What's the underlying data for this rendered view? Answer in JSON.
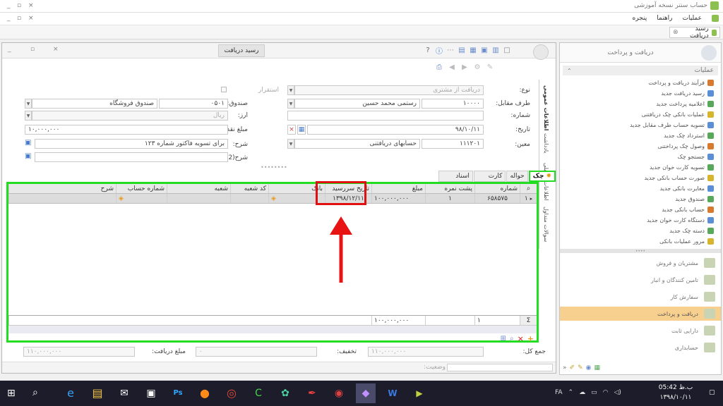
{
  "app": {
    "title": "حساب سنتر نسخه آموزشی"
  },
  "menu": {
    "items": [
      "عملیات",
      "راهنما",
      "پنجره"
    ]
  },
  "doc_tab": {
    "label": "رسید دریافت"
  },
  "window": {
    "title": "رسید دریافت"
  },
  "side_tabs": [
    "اطلاعات عمومی",
    "یادداشت",
    "اطلاعات تکمیلی",
    "سوالات متداول"
  ],
  "form": {
    "type_label": "نوع:",
    "type_value": "دریافت از مشتری",
    "counterparty_label": "طرف مقابل:",
    "counterparty_code": "۱۰۰۰۰",
    "counterparty_name": "رستمی محمد حسین",
    "number_label": "شماره:",
    "date_label": "تاریخ:",
    "date_value": "۹۸/۱۰/۱۱",
    "entity_label": "معین:",
    "entity_code": "۱۱۱۲۰۱",
    "entity_name": "حسابهای دریافتنی",
    "fund_label": "صندوق:",
    "fund_code": "۰۵۰۱",
    "fund_name": "صندوق فروشگاه",
    "currency_label": "ارز:",
    "currency_value": "ریال",
    "cash_label": "مبلغ نقد:",
    "cash_value": "۱۰,۰۰۰,۰۰۰",
    "desc_label": "شرح:",
    "desc_value": "برای تسویه فاکتور شماره ۱۲۳",
    "desc2_label": "شرح(2):",
    "fixed_label": "استقرار"
  },
  "detail_tabs": [
    "چک",
    "حواله",
    "کارت خوان",
    "اسناد مرتبط"
  ],
  "grid": {
    "columns": [
      "شماره",
      "پشت نمره",
      "مبلغ",
      "تاریخ سررسید",
      "بانک",
      "کد شعبه",
      "شعبه",
      "شماره حساب",
      "شرح"
    ],
    "rows": [
      [
        "۶۵۸۵۷۵",
        "۱",
        "۱۰۰,۰۰۰,۰۰۰",
        "۱۳۹۸/۱۲/۱۱",
        "",
        "",
        "",
        "",
        ""
      ]
    ],
    "row_num": "۱",
    "footer_count": "۱",
    "footer_sum": "۱۰۰,۰۰۰,۰۰۰"
  },
  "totals": {
    "total_label": "جمع کل:",
    "total_value": "۱۱۰,۰۰۰,۰۰۰",
    "discount_label": "تخفیف:",
    "discount_value": "۰",
    "received_label": "مبلغ دریافت:",
    "received_value": "۱۱۰,۰۰۰,۰۰۰",
    "status_label": "وضعیت:"
  },
  "panel": {
    "header": "دریافت و پرداخت",
    "ops_title": "عملیات",
    "ops": [
      "فرآیند دریافت و پرداخت",
      "رسید دریافت جدید",
      "اعلامیه پرداخت جدید",
      "عملیات بانکی چک دریافتنی",
      "تسویه حساب طرف مقابل جدید",
      "استرداد چک جدید",
      "وصول چک پرداختنی",
      "جستجو چک",
      "تسویه کارت خوان جدید",
      "صورت حساب بانکی جدید",
      "مغایرت بانکی جدید",
      "صندوق جدید",
      "حساب بانکی جدید",
      "دستگاه کارت خوان جدید",
      "دسته چک جدید",
      "مرور عملیات بانکی"
    ],
    "ops_colors": [
      "#d77a2d",
      "#5a8fd6",
      "#58a85a",
      "#d6b52d",
      "#5a8fd6",
      "#58a85a",
      "#d77a2d",
      "#5a8fd6",
      "#58a85a",
      "#d6b52d",
      "#5a8fd6",
      "#58a85a",
      "#d77a2d",
      "#5a8fd6",
      "#58a85a",
      "#d6b52d"
    ],
    "nav": [
      "مشتریان و فروش",
      "تامین کنندگان و انبار",
      "سفارش کار",
      "دریافت و پرداخت",
      "دارایی ثابت",
      "حسابداری"
    ],
    "nav_active_color": "#f7cf8e"
  },
  "taskbar": {
    "lang": "FA",
    "time": "05:42 ب.ظ",
    "date": "۱۳۹۸/۱۰/۱۱"
  },
  "colors": {
    "highlight_green": "#22dd22",
    "highlight_red": "#e01010",
    "arrow_red": "#e81313"
  }
}
